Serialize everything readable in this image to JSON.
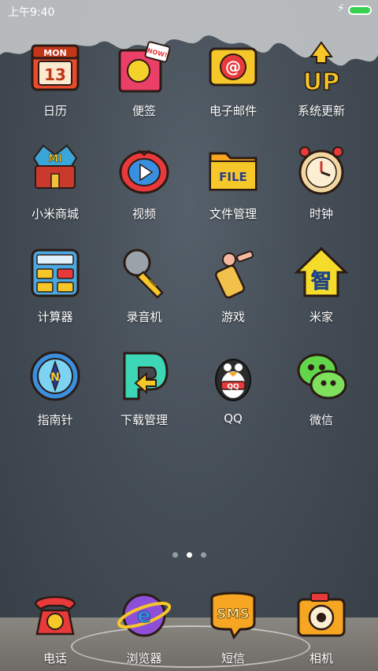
{
  "status_bar": {
    "time": "上午9:40",
    "charging_icon": "lightning-icon",
    "battery_icon": "battery-icon",
    "battery_color": "#37d14f"
  },
  "apps": [
    {
      "label": "日历",
      "icon": "calendar-icon",
      "badge_top": "MON",
      "badge_day": "13"
    },
    {
      "label": "便签",
      "icon": "note-icon",
      "badge_top": "NOW!"
    },
    {
      "label": "电子邮件",
      "icon": "email-icon",
      "badge_top": "@"
    },
    {
      "label": "系统更新",
      "icon": "update-icon",
      "badge_top": "UP"
    },
    {
      "label": "小米商城",
      "icon": "mi-store-icon",
      "badge_top": "MI"
    },
    {
      "label": "视频",
      "icon": "video-icon"
    },
    {
      "label": "文件管理",
      "icon": "folder-icon",
      "badge_top": "FILE"
    },
    {
      "label": "时钟",
      "icon": "clock-icon"
    },
    {
      "label": "计算器",
      "icon": "calculator-icon"
    },
    {
      "label": "录音机",
      "icon": "microphone-icon"
    },
    {
      "label": "游戏",
      "icon": "game-icon"
    },
    {
      "label": "米家",
      "icon": "smart-home-icon",
      "badge_top": "智"
    },
    {
      "label": "指南针",
      "icon": "compass-icon",
      "badge_top": "N"
    },
    {
      "label": "下载管理",
      "icon": "download-icon"
    },
    {
      "label": "QQ",
      "icon": "qq-penguin-icon",
      "badge_top": "QQ"
    },
    {
      "label": "微信",
      "icon": "wechat-icon"
    }
  ],
  "pager": {
    "pages": 3,
    "active": 1
  },
  "dock": [
    {
      "label": "电话",
      "icon": "phone-icon"
    },
    {
      "label": "浏览器",
      "icon": "browser-icon",
      "badge_top": "e"
    },
    {
      "label": "短信",
      "icon": "sms-icon",
      "badge_top": "SMS"
    },
    {
      "label": "相机",
      "icon": "camera-icon"
    }
  ]
}
